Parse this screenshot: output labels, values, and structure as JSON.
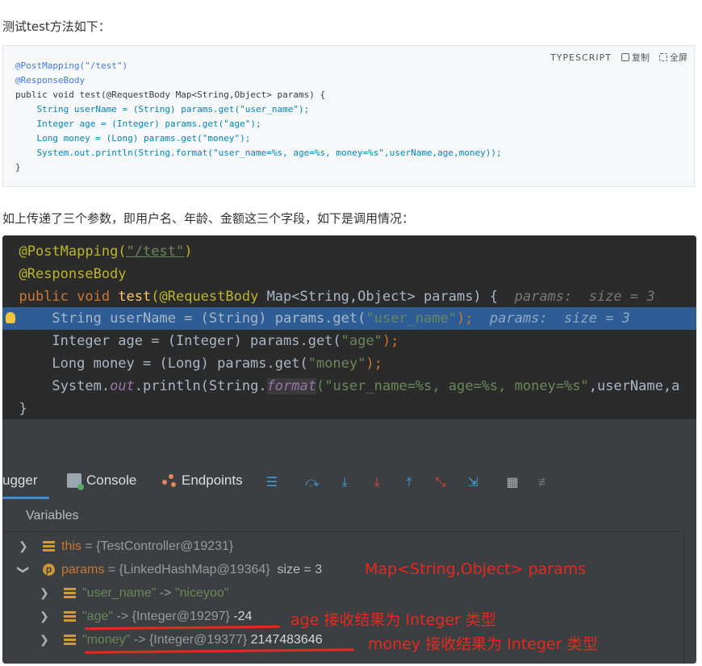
{
  "intro_text": "测试test方法如下：",
  "codebox": {
    "language": "TYPESCRIPT",
    "copy_label": "复制",
    "fullscreen_label": "全屏",
    "lines": [
      "@PostMapping(\"/test\")",
      "@ResponseBody",
      "public void test(@RequestBody Map<String,Object> params) {",
      "    String userName = (String) params.get(\"user_name\");",
      "    Integer age = (Integer) params.get(\"age\");",
      "    Long money = (Long) params.get(\"money\");",
      "    System.out.println(String.format(\"user_name=%s, age=%s, money=%s\",userName,age,money));",
      "}"
    ]
  },
  "explain_text": "如上传递了三个参数，即用户名、年龄、金额这三个字段，如下是调用情况：",
  "editor": {
    "annotation1": "@PostMapping(",
    "annotation1_str": "\"/test\"",
    "annotation1_end": ")",
    "annotation2": "@ResponseBody",
    "sig_kw": "public void ",
    "sig_fn": "test",
    "sig_ann": "(@RequestBody",
    "sig_rest": " Map<String,Object> params) {",
    "sig_hint": "  params:  size = 3",
    "l1_pre": "    String userName = (String) params.get(",
    "l1_str": "\"user_name\"",
    "l1_end": ");",
    "l1_hint": "  params:  size = 3",
    "l2_pre": "    Integer age = (Integer) params.get(",
    "l2_str": "\"age\"",
    "l2_end": ");",
    "l3_pre": "    Long money = (Long) params.get(",
    "l3_str": "\"money\"",
    "l3_end": ");",
    "l4_pre": "    System.",
    "l4_out": "out",
    "l4_mid": ".println(String.",
    "l4_fmt": "format",
    "l4_str": "(\"user_name=%s, age=%s, money=%s\"",
    "l4_end": ",userName,a",
    "close": "}"
  },
  "debugger": {
    "tab_debugger": "ugger",
    "tab_console": "Console",
    "tab_endpoints": "Endpoints",
    "variables_title": "Variables",
    "rows": {
      "this_name": "this",
      "this_val": " = {TestController@19231}",
      "params_name": "params",
      "params_val": " = {LinkedHashMap@19364}",
      "params_size": "  size = 3",
      "user_key": "\"user_name\"",
      "user_arrow": " -> ",
      "user_val": "\"niceyoo\"",
      "age_key": "\"age\"",
      "age_arrow": " -> {Integer@19297} ",
      "age_val": "-24",
      "money_key": "\"money\"",
      "money_arrow": " -> {Integer@19377} ",
      "money_val": "2147483646"
    }
  },
  "annotations": {
    "params_note": "Map<String,Object> params",
    "age_note": "age 接收结果为 Integer 类型",
    "money_note": "money 接收结果为 Integer 类型"
  },
  "colors": {
    "annotation_red": "#e8281e",
    "highlight_line": "#2d5d94",
    "editor_bg": "#2b2b2b",
    "panel_bg": "#3c3f41"
  }
}
